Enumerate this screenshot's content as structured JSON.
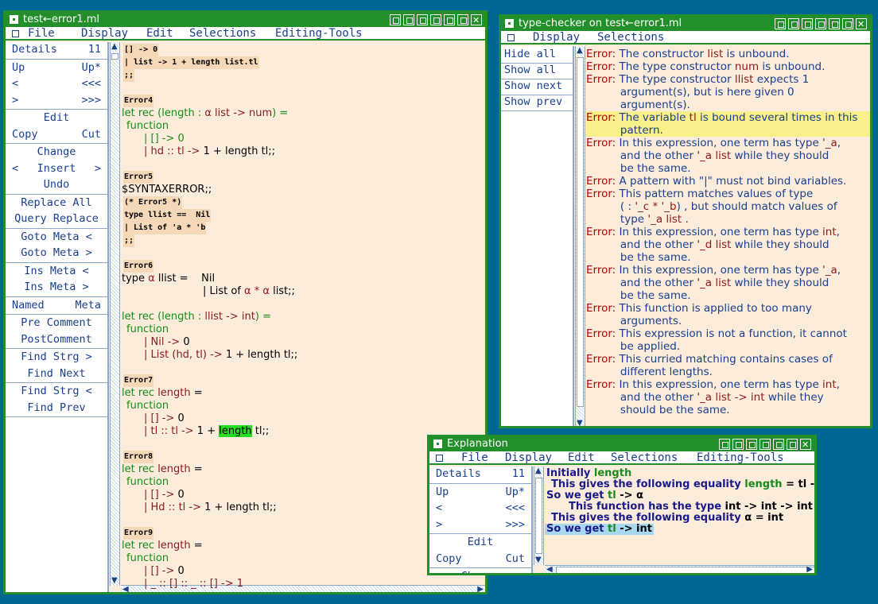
{
  "editor_window": {
    "title": "test←error1.ml",
    "menu": [
      "File",
      "Display",
      "Edit",
      "Selections",
      "Editing-Tools"
    ],
    "panel": [
      {
        "left": "Details",
        "right": "11"
      },
      {
        "left": "Up",
        "right": "Up*"
      },
      {
        "left": "<",
        "right": "<<<"
      },
      {
        "left": ">",
        "right": ">>>"
      },
      {
        "center": "Edit"
      },
      {
        "left": "Copy",
        "right": "Cut"
      },
      {
        "center": "Change"
      },
      {
        "left": "<",
        "center": "Insert",
        "right": ">"
      },
      {
        "center": "Undo"
      },
      {
        "center": "Replace All"
      },
      {
        "center": "Query Replace"
      },
      {
        "center": "Goto Meta <"
      },
      {
        "center": "Goto Meta >"
      },
      {
        "center": "Ins Meta <"
      },
      {
        "center": "Ins Meta >"
      },
      {
        "left": "Named",
        "right": "Meta"
      },
      {
        "center": "Pre Comment"
      },
      {
        "center": "PostComment"
      },
      {
        "center": "Find Strg >"
      },
      {
        "center": "Find Next"
      },
      {
        "center": "Find Strg <"
      },
      {
        "center": "Find Prev"
      }
    ],
    "code": {
      "l1": "[] -> 0",
      "l2": "| list -> 1 + length list.tl",
      "l3": ";;",
      "e4": "Error4",
      "e4a": "let rec (length : ",
      "e4a2": "α list -> num",
      "e4a3": ") =",
      "e4b": "function",
      "e4c": "| [] -> 0",
      "e4d1": "| hd :: tl ->",
      "e4d2": " 1 + length tl;;",
      "e5": "Error5",
      "e5a": "$SYNTAXERROR;;",
      "e5b": "(* Error5 *)",
      "e5c": "type llist ==  Nil",
      "e5d": "| List of 'a * 'b",
      "e5e": ";;",
      "e6": "Error6",
      "e6a1": "type ",
      "e6a2": "α",
      "e6a3": " llist =    Nil",
      "e6b1": "| List of ",
      "e6b2": "α * α",
      "e6b3": " list;;",
      "e6c1": "let rec (length : ",
      "e6c2": "llist -> int",
      "e6c3": ") =",
      "e6d": "function",
      "e6e1": "| Nil ->",
      "e6e2": " 0",
      "e6f1": "| List (hd, tl) ->",
      "e6f2": " 1 + length tl;;",
      "e7": "Error7",
      "e7a1": "let rec ",
      "e7a2": "length",
      "e7a3": " =",
      "e7b": "function",
      "e7c1": "| [] ->",
      "e7c2": " 0",
      "e7d1": "| tl :: tl ->",
      "e7d2": " 1 + ",
      "e7d3": "length",
      "e7d4": " tl;;",
      "e8": "Error8",
      "e8a1": "let rec ",
      "e8a2": "length",
      "e8a3": " =",
      "e8b": "function",
      "e8c1": "| [] ->",
      "e8c2": " 0",
      "e8d1": "| Hd :: tl ->",
      "e8d2": " 1 + length tl;;",
      "e9": "Error9",
      "e9a1": "let rec ",
      "e9a2": "length",
      "e9a3": " =",
      "e9b": "function",
      "e9c1": "| [] ->",
      "e9c2": " 0",
      "e9d": "| _ :: [] :: _ :: [] -> 1"
    }
  },
  "checker_window": {
    "title": "type-checker on test←error1.ml",
    "menu": [
      "Display",
      "Selections"
    ],
    "panel": [
      "Hide all",
      "Show all",
      "Show next",
      "Show prev"
    ],
    "errors": [
      {
        "l": [
          "The constructor ",
          "list",
          " is unbound."
        ]
      },
      {
        "l": [
          "The type constructor ",
          "num",
          " is unbound."
        ]
      },
      {
        "l": [
          "The type constructor ",
          "llist",
          " expects 1"
        ],
        "more": [
          "argument(s), but is here given 0",
          "argument(s)."
        ]
      },
      {
        "l": [
          "The variable ",
          "tl",
          " is bound several times in this"
        ],
        "more": [
          "pattern."
        ],
        "hl": true
      },
      {
        "l": [
          "In this expression, one term has type ",
          "'_a",
          ","
        ],
        "more": [
          "and the other ",
          "'_a list",
          " while they should",
          "be the same."
        ]
      },
      {
        "l": [
          "A pattern with \"|\" must not bind variables.",
          "",
          ""
        ]
      },
      {
        "l": [
          "This pattern matches values of type",
          "",
          ""
        ],
        "more": [
          "( : '_c * '_b) , but should match values of",
          "type '_a list ."
        ]
      },
      {
        "l": [
          "In this expression, one term has type ",
          "int",
          ","
        ],
        "more": [
          "and the other ",
          "'_d list",
          " while they should",
          "be the same."
        ]
      },
      {
        "l": [
          "In this expression, one term has type ",
          "'_a",
          ","
        ],
        "more": [
          "and the other ",
          "'_a list",
          " while they should",
          "be the same."
        ]
      },
      {
        "l": [
          "This function is applied to too many",
          "",
          ""
        ],
        "more": [
          "arguments."
        ]
      },
      {
        "l": [
          "This expression is not a function, it cannot",
          "",
          ""
        ],
        "more": [
          "be applied."
        ]
      },
      {
        "l": [
          "This curried matching contains cases of",
          "",
          ""
        ],
        "more": [
          "different lengths."
        ]
      },
      {
        "l": [
          "In this expression, one term has type ",
          "int",
          ","
        ],
        "more": [
          "and the other ",
          "'_a list -> int",
          " while they",
          "should be the same."
        ]
      }
    ],
    "error_label": "Error:"
  },
  "explanation_window": {
    "title": "Explanation",
    "menu": [
      "File",
      "Display",
      "Edit",
      "Selections",
      "Editing-Tools"
    ],
    "panel": [
      {
        "left": "Details",
        "right": "11"
      },
      {
        "left": "Up",
        "right": "Up*"
      },
      {
        "left": "<",
        "right": "<<<"
      },
      {
        "left": ">",
        "right": ">>>"
      },
      {
        "center": "Edit"
      },
      {
        "left": "Copy",
        "right": "Cut"
      },
      {
        "center": "Change"
      }
    ],
    "lines": {
      "a1": "Initially ",
      "a2": "length",
      "b1": "This gives the following equality ",
      "b2": "length",
      " b3": "= tl ->",
      "c1": "So we get ",
      "c2": "tl",
      "c3": " -> α",
      "d1": "This function has the type ",
      "d2": "int -> int -> int",
      "e1": "This gives the following equality ",
      "e2": "α = int",
      "f1": "So we get ",
      "f2": "tl",
      "f3": " -> int"
    }
  }
}
